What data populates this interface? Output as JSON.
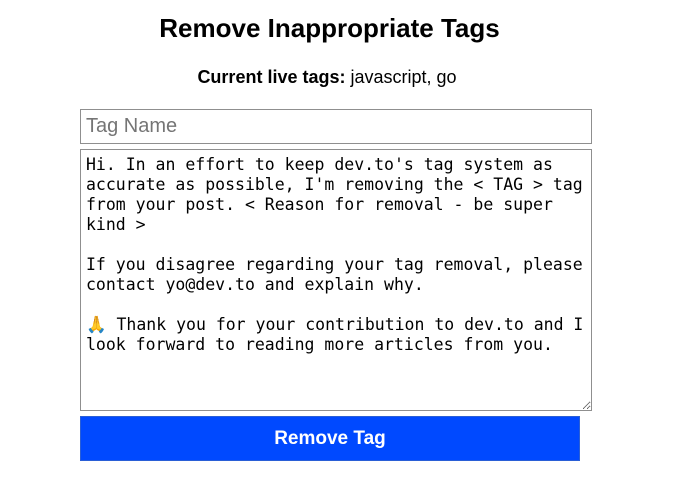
{
  "page": {
    "title": "Remove Inappropriate Tags"
  },
  "live_tags": {
    "label": "Current live tags:",
    "value": "javascript, go"
  },
  "form": {
    "tag_name_placeholder": "Tag Name",
    "tag_name_value": "",
    "message_value": "Hi. In an effort to keep dev.to's tag system as accurate as possible, I'm removing the < TAG > tag from your post. < Reason for removal - be super kind >\n\nIf you disagree regarding your tag removal, please contact yo@dev.to and explain why.\n\n🙏 Thank you for your contribution to dev.to and I look forward to reading more articles from you.",
    "submit_label": "Remove Tag"
  },
  "colors": {
    "button_bg": "#0049ff",
    "button_text": "#ffffff",
    "border": "#8f8f8f"
  }
}
